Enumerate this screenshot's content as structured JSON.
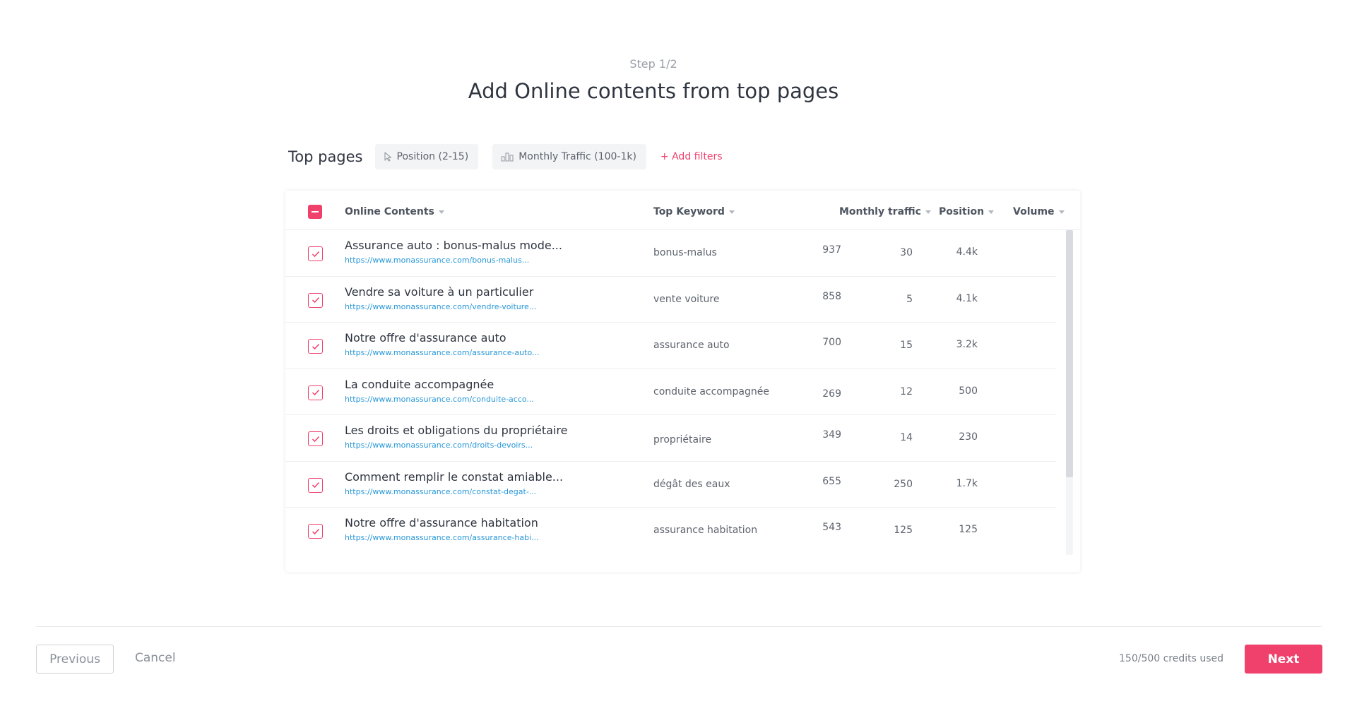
{
  "header": {
    "step": "Step 1/2",
    "title": "Add Online contents from top pages"
  },
  "filters": {
    "label": "Top pages",
    "chips": [
      {
        "label": "Position (2-15)",
        "icon": "cursor-icon"
      },
      {
        "label": "Monthly Traffic (100-1k)",
        "icon": "bar-chart-icon"
      }
    ],
    "add_label": "+ Add filters"
  },
  "table": {
    "columns": {
      "contents": "Online Contents",
      "keyword": "Top Keyword",
      "traffic": "Monthly traffic",
      "position": "Position",
      "volume": "Volume"
    },
    "rows": [
      {
        "title": "Assurance auto : bonus-malus mode...",
        "url": "https://www.monassurance.com/bonus-malus...",
        "keyword": "bonus-malus",
        "traffic": "937",
        "position": "30",
        "volume": "4.4k",
        "checked": true
      },
      {
        "title": "Vendre sa voiture à un particulier",
        "url": "https://www.monassurance.com/vendre-voiture...",
        "keyword": "vente voiture",
        "traffic": "858",
        "position": "5",
        "volume": "4.1k",
        "checked": true
      },
      {
        "title": "Notre offre d'assurance auto",
        "url": "https://www.monassurance.com/assurance-auto...",
        "keyword": "assurance auto",
        "traffic": "700",
        "position": "15",
        "volume": "3.2k",
        "checked": true
      },
      {
        "title": "La conduite accompagnée",
        "url": "https://www.monassurance.com/conduite-acco...",
        "keyword": "conduite accompagnée",
        "traffic": "269",
        "position": "12",
        "volume": "500",
        "checked": true
      },
      {
        "title": "Les droits et obligations du propriétaire",
        "url": "https://www.monassurance.com/droits-devoirs...",
        "keyword": "propriétaire",
        "traffic": "349",
        "position": "14",
        "volume": "230",
        "checked": true
      },
      {
        "title": "Comment remplir le constat amiable...",
        "url": "https://www.monassurance.com/constat-degat-...",
        "keyword": "dégât des eaux",
        "traffic": "655",
        "position": "250",
        "volume": "1.7k",
        "checked": true
      },
      {
        "title": "Notre offre d'assurance habitation",
        "url": "https://www.monassurance.com/assurance-habi...",
        "keyword": "assurance habitation",
        "traffic": "543",
        "position": "125",
        "volume": "125",
        "checked": true
      }
    ]
  },
  "footer": {
    "previous_label": "Previous",
    "cancel_label": "Cancel",
    "credits": "150/500 credits used",
    "next_label": "Next"
  },
  "colors": {
    "accent": "#f0416c",
    "link": "#2797d8"
  }
}
